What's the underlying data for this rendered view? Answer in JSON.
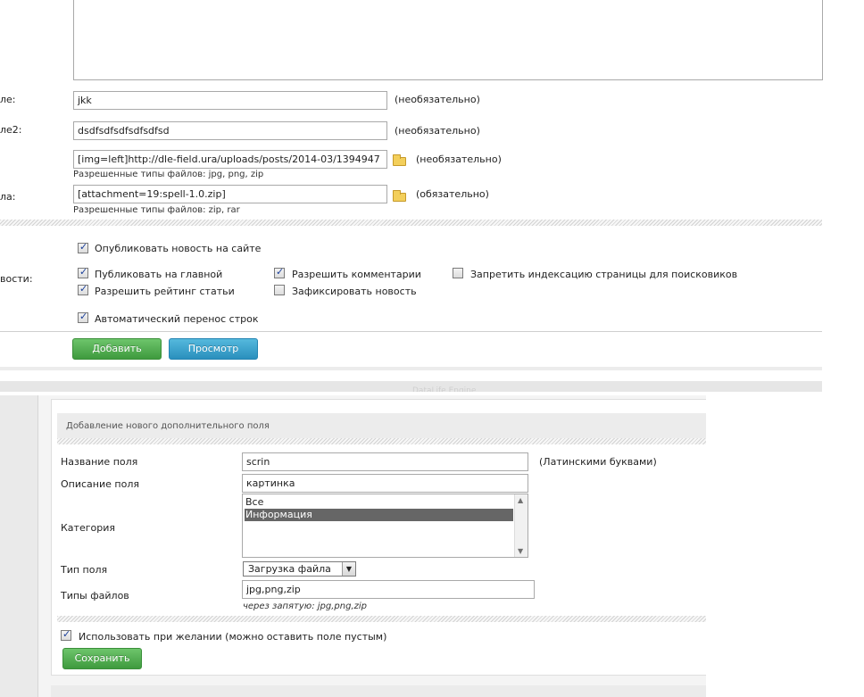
{
  "top_form": {
    "fields": [
      {
        "label": "ле:",
        "value": "jkk",
        "hint": "(необязательно)"
      },
      {
        "label": "ле2:",
        "value": "dsdfsdfsdfsdfsdfsd",
        "hint": "(необязательно)"
      },
      {
        "label": "",
        "value": "[img=left]http://dle-field.ura/uploads/posts/2014-03/1394947",
        "hint": "(необязательно)",
        "subhint": "Разрешенные типы файлов: jpg, png, zip"
      },
      {
        "label": "ла:",
        "value": "[attachment=19:spell-1.0.zip]",
        "hint": "(обязательно)",
        "subhint": "Разрешенные типы файлов: zip, rar"
      }
    ],
    "options_label": "вости:",
    "options": {
      "publish_site": {
        "label": "Опубликовать новость на сайте",
        "checked": true
      },
      "publish_main": {
        "label": "Публиковать на главной",
        "checked": true
      },
      "allow_rating": {
        "label": "Разрешить рейтинг статьи",
        "checked": true
      },
      "allow_comments": {
        "label": "Разрешить комментарии",
        "checked": true
      },
      "pin_news": {
        "label": "Зафиксировать новость",
        "checked": false
      },
      "no_index": {
        "label": "Запретить индексацию страницы для поисковиков",
        "checked": false
      },
      "auto_wrap": {
        "label": "Автоматический перенос строк",
        "checked": true
      }
    },
    "buttons": {
      "add": "Добавить",
      "preview": "Просмотр"
    },
    "footer_faded": "DataLife Engine"
  },
  "bottom_form": {
    "title": "Добавление нового дополнительного поля",
    "name_label": "Название поля",
    "name_value": "scrin",
    "name_hint": "(Латинскими буквами)",
    "desc_label": "Описание поля",
    "desc_value": "картинка",
    "category_label": "Категория",
    "category_options": [
      "Все",
      "Информация"
    ],
    "category_selected": "Информация",
    "type_label": "Тип поля",
    "type_value": "Загрузка файла",
    "filetypes_label": "Типы файлов",
    "filetypes_value": "jpg,png,zip",
    "filetypes_hint": "через запятую: jpg,png,zip",
    "optional_label": "Использовать при желании (можно оставить поле пустым)",
    "optional_checked": true,
    "save": "Сохранить"
  },
  "colors": {
    "green": "#4ca94b",
    "blue": "#3aa2cc",
    "selected": "#666666"
  }
}
